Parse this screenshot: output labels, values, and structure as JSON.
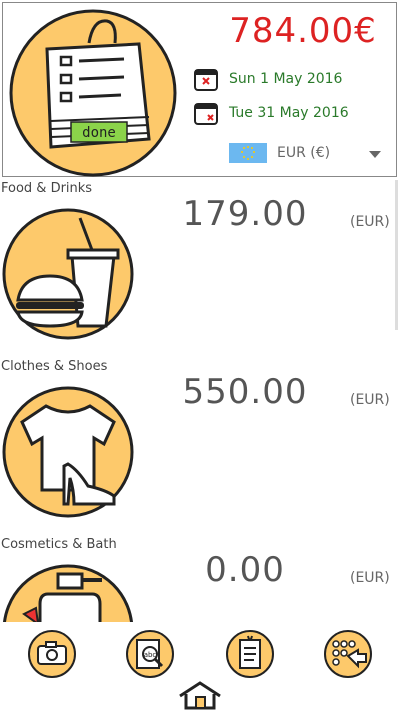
{
  "header": {
    "total": "784.00€",
    "badge": "done",
    "start_date": "Sun 1 May 2016",
    "end_date": "Tue 31 May 2016",
    "currency": "EUR (€)"
  },
  "categories": [
    {
      "name": "Food & Drinks",
      "amount": "179.00",
      "unit": "(EUR)",
      "icon": "food-drinks-icon"
    },
    {
      "name": "Clothes & Shoes",
      "amount": "550.00",
      "unit": "(EUR)",
      "icon": "clothes-shoes-icon"
    },
    {
      "name": "Cosmetics & Bath",
      "amount": "0.00",
      "unit": "(EUR)",
      "icon": "cosmetics-bath-icon"
    }
  ],
  "colors": {
    "accent": "#fdc96b",
    "total": "#dd2222",
    "date": "#2a7a2a",
    "badge": "#8bd34a"
  },
  "toolbar": [
    "camera-icon",
    "text-search-icon",
    "document-icon",
    "keypad-arrow-icon"
  ]
}
